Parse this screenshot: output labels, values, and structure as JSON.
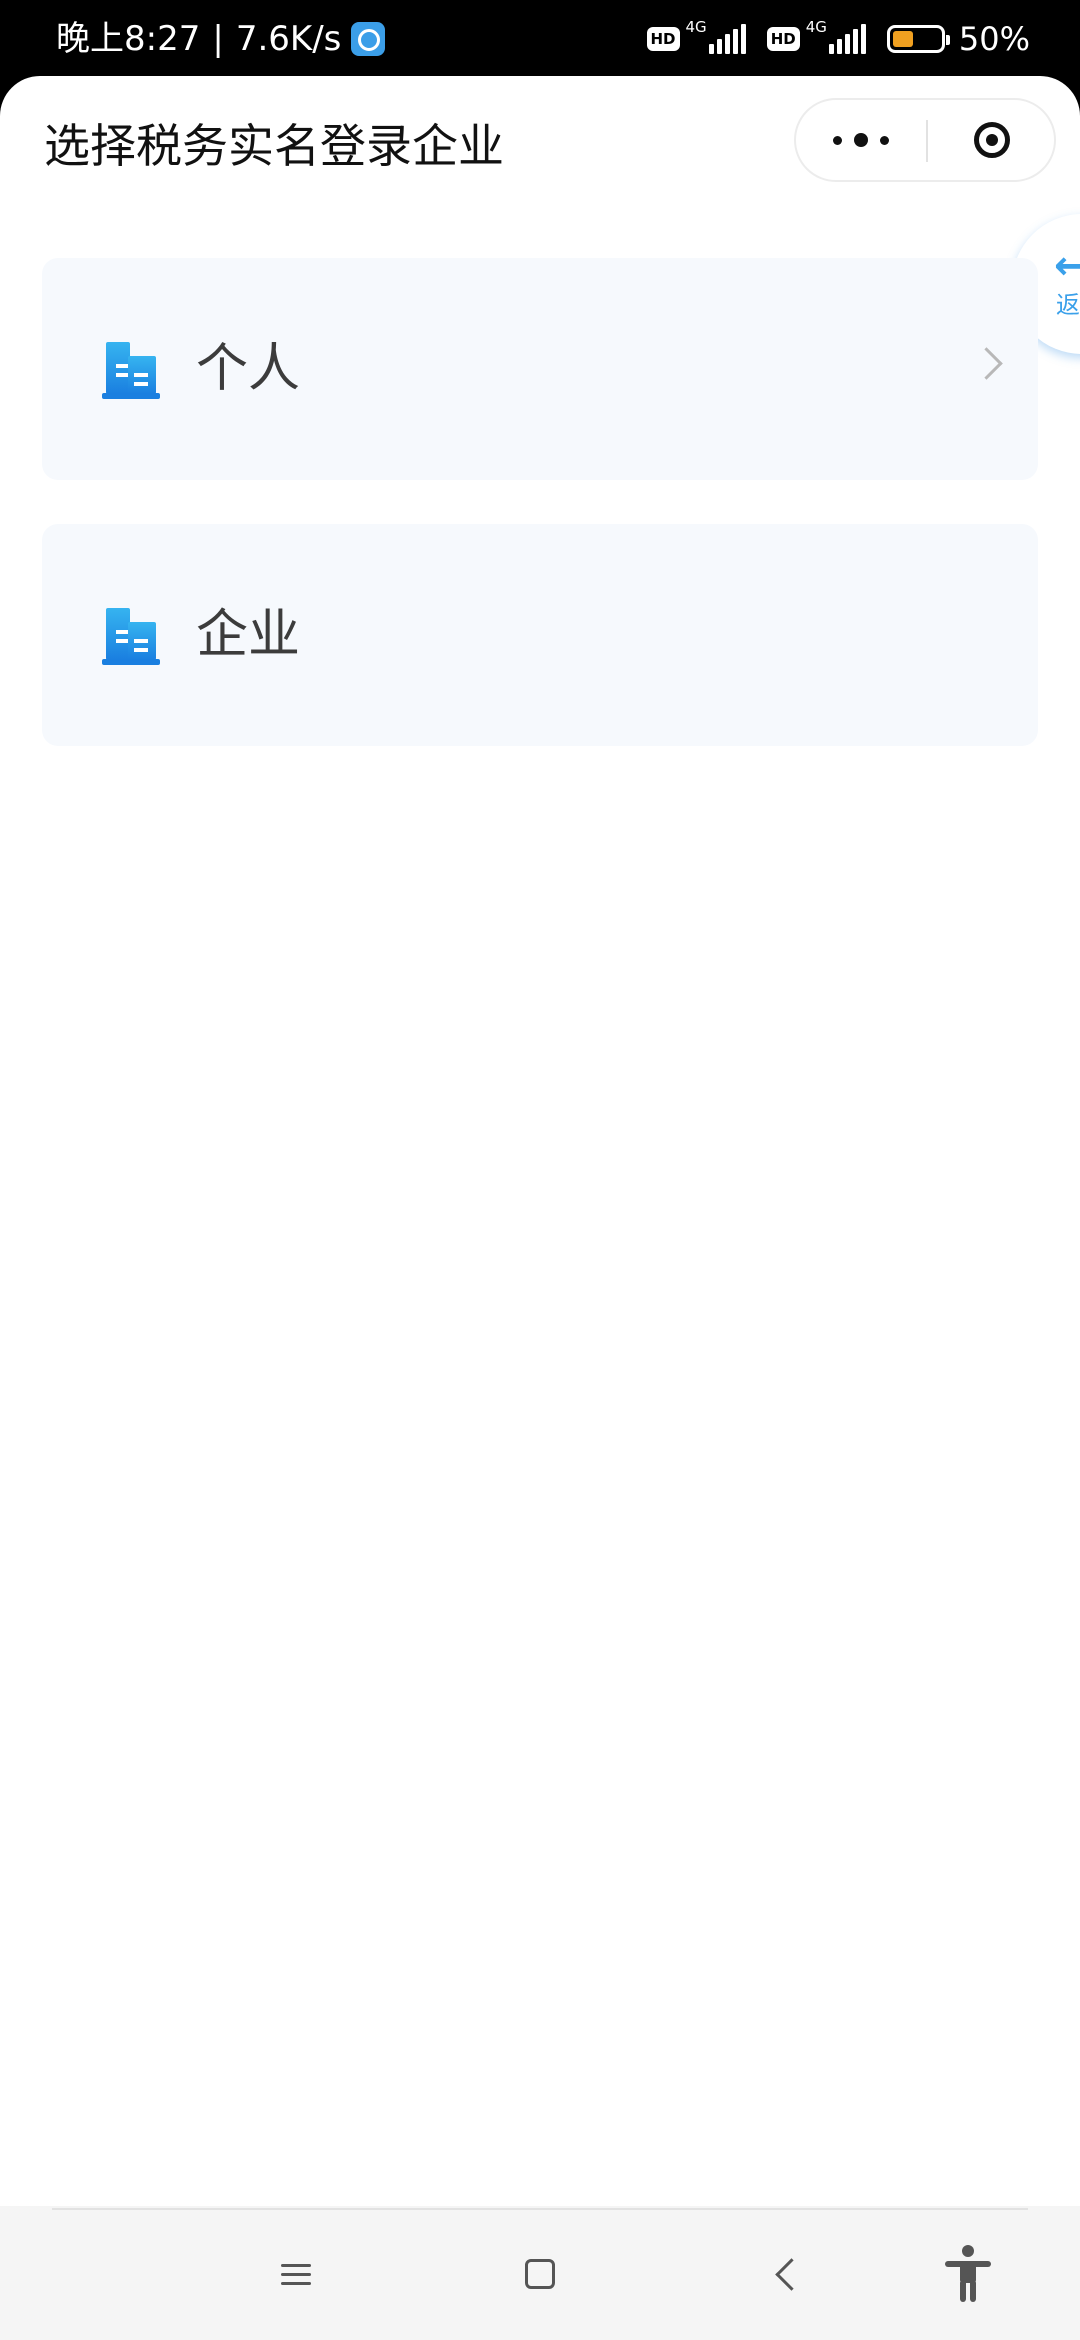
{
  "status_bar": {
    "time": "晚上8:27",
    "separator": "|",
    "speed": "7.6K/s",
    "hd1": "HD",
    "net1": "4G",
    "hd2": "HD",
    "net2": "4G",
    "battery_level": 0.5,
    "battery_text": "50%",
    "battery_color": "#f0a020"
  },
  "nav": {
    "title": "选择税务实名登录企业",
    "more_icon": "more-dots-icon",
    "close_icon": "target-close-icon"
  },
  "float_back": {
    "arrow": "←",
    "label": "返"
  },
  "options": [
    {
      "label": "个人",
      "icon": "building-icon",
      "has_chevron": true
    },
    {
      "label": "企业",
      "icon": "building-icon",
      "has_chevron": false
    }
  ],
  "colors": {
    "accent": "#1e90e8",
    "card_bg": "#f6f9fd"
  }
}
